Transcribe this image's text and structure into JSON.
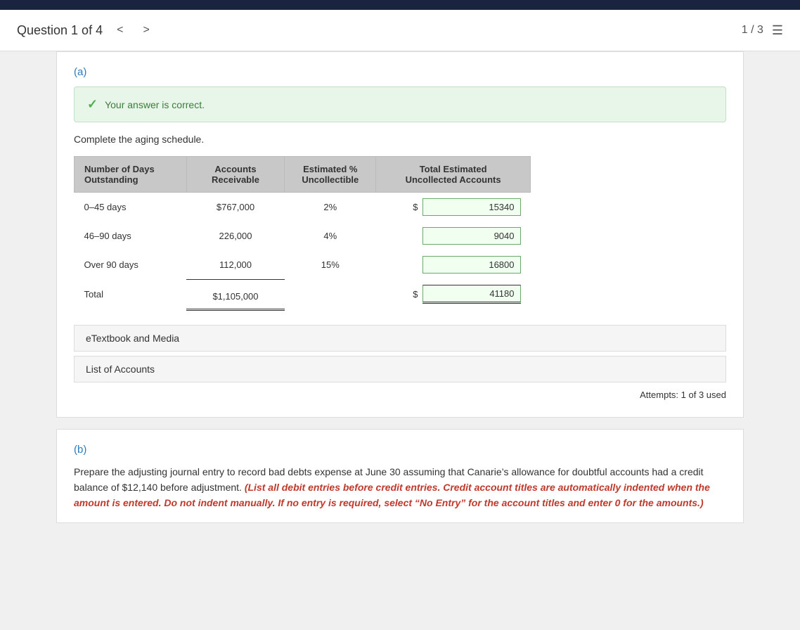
{
  "topbar": {},
  "header": {
    "question_title": "Question 1 of 4",
    "page_indicator": "1 / 3",
    "prev_arrow": "<",
    "next_arrow": ">"
  },
  "part_a": {
    "label": "(a)",
    "correct_message": "Your answer is correct.",
    "instruction": "Complete the aging schedule.",
    "table": {
      "headers": [
        "Number of Days Outstanding",
        "Accounts Receivable",
        "Estimated % Uncollectible",
        "Total Estimated Uncollected Accounts"
      ],
      "rows": [
        {
          "days": "0–45 days",
          "ar": "$767,000",
          "pct": "2%",
          "dollar": "$",
          "total": "15340"
        },
        {
          "days": "46–90 days",
          "ar": "226,000",
          "pct": "4%",
          "dollar": "",
          "total": "9040"
        },
        {
          "days": "Over 90 days",
          "ar": "112,000",
          "pct": "15%",
          "dollar": "",
          "total": "16800"
        },
        {
          "days": "Total",
          "ar": "$1,105,000",
          "pct": "",
          "dollar": "$",
          "total": "41180"
        }
      ]
    },
    "etextbook_label": "eTextbook and Media",
    "list_of_accounts_label": "List of Accounts",
    "attempts": "Attempts: 1 of 3 used"
  },
  "part_b": {
    "label": "(b)",
    "text_normal": "Prepare the adjusting journal entry to record bad debts expense at June 30 assuming that Canarie’s allowance for doubtful accounts had a credit balance of $12,140 before adjustment.",
    "text_red": "(List all debit entries before credit entries. Credit account titles are automatically indented when the amount is entered. Do not indent manually. If no entry is required, select “No Entry” for the account titles and enter 0 for the amounts.)"
  }
}
